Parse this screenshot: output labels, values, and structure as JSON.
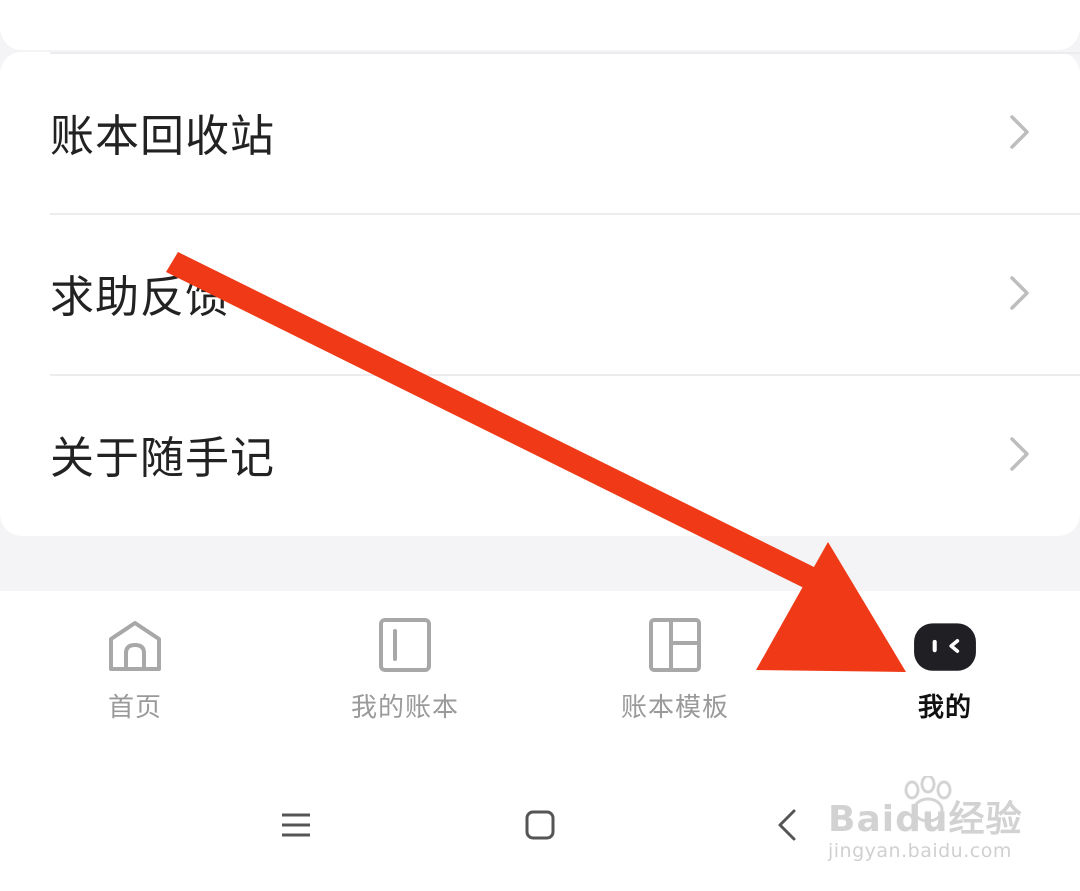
{
  "menu": {
    "items": [
      {
        "label": "账本回收站"
      },
      {
        "label": "求助反馈"
      },
      {
        "label": "关于随手记"
      }
    ]
  },
  "tabbar": {
    "tabs": [
      {
        "label": "首页",
        "icon": "home-icon",
        "active": false
      },
      {
        "label": "我的账本",
        "icon": "book-icon",
        "active": false
      },
      {
        "label": "账本模板",
        "icon": "template-grid-icon",
        "active": false
      },
      {
        "label": "我的",
        "icon": "mascot-face-icon",
        "active": true
      }
    ]
  },
  "system_nav": {
    "buttons": [
      {
        "icon": "menu-icon"
      },
      {
        "icon": "home-square-icon"
      },
      {
        "icon": "back-icon"
      }
    ]
  },
  "annotation": {
    "arrow_color": "#f03a17"
  },
  "watermark": {
    "brand": "Baidu经验",
    "url": "jingyan.baidu.com"
  }
}
